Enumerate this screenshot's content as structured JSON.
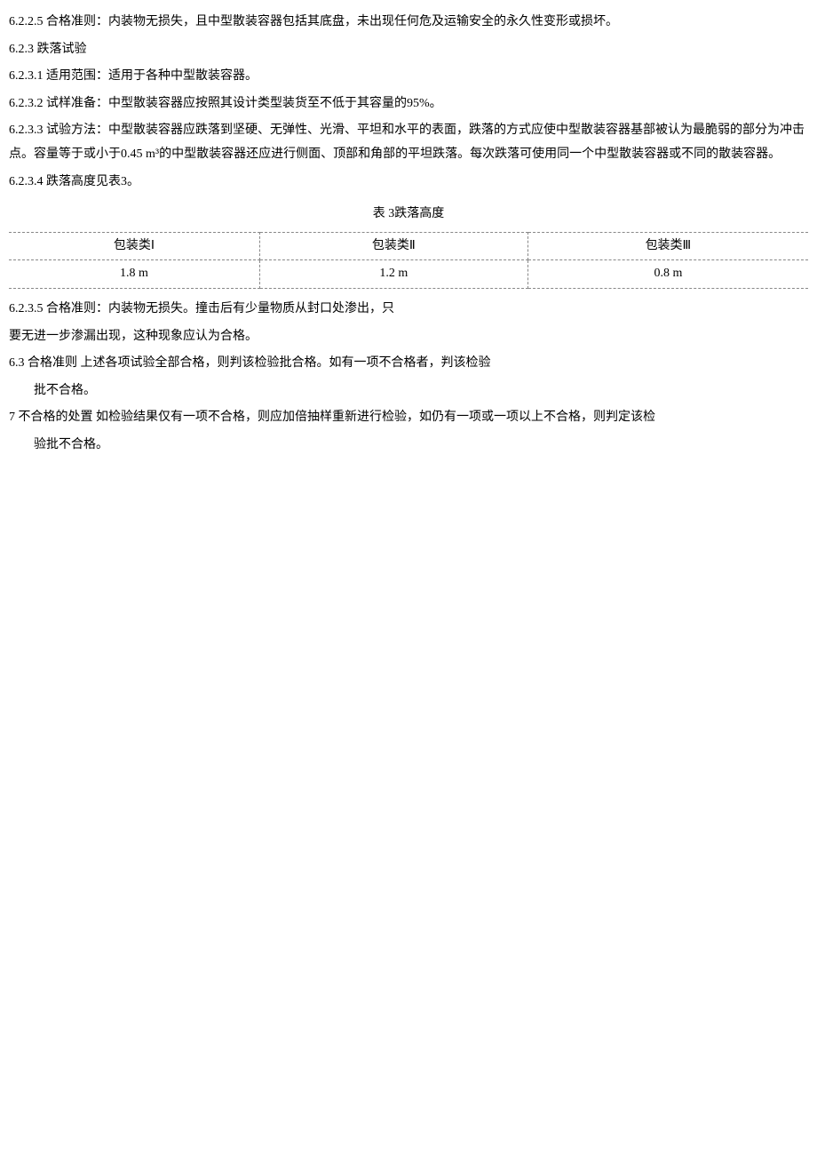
{
  "p_6_2_2_5": "6.2.2.5  合格准则：内装物无损失，且中型散装容器包括其底盘，未出现任何危及运输安全的永久性变形或损坏。",
  "p_6_2_3": "6.2.3 跌落试验",
  "p_6_2_3_1": "6.2.3.1  适用范围：适用于各种中型散装容器。",
  "p_6_2_3_2": "6.2.3.2  试样准备：中型散装容器应按照其设计类型装货至不低于其容量的95%。",
  "p_6_2_3_3": "6.2.3.3  试验方法：中型散装容器应跌落到坚硬、无弹性、光滑、平坦和水平的表面，跌落的方式应使中型散装容器基部被认为最脆弱的部分为冲击点。容量等于或小于0.45  m³的中型散装容器还应进行侧面、顶部和角部的平坦跌落。每次跌落可使用同一个中型散装容器或不同的散装容器。",
  "p_6_2_3_4": "6.2.3.4  跌落高度见表3。",
  "table_caption": "表 3跌落高度",
  "table": {
    "headers": [
      "包装类Ⅰ",
      "包装类Ⅱ",
      "包装类Ⅲ"
    ],
    "row": [
      "1.8  m",
      "1.2  m",
      "0.8  m"
    ]
  },
  "p_6_2_3_5_a": "6.2.3.5  合格准则：内装物无损失。撞击后有少量物质从封口处渗出，只",
  "p_6_2_3_5_b": "要无进一步渗漏出现，这种现象应认为合格。",
  "p_6_3_a": "6.3 合格准则 上述各项试验全部合格，则判该检验批合格。如有一项不合格者，判该检验",
  "p_6_3_b": "批不合格。",
  "p_7_a": "7 不合格的处置 如检验结果仅有一项不合格，则应加倍抽样重新进行检验，如仍有一项或一项以上不合格，则判定该检",
  "p_7_b": "验批不合格。"
}
